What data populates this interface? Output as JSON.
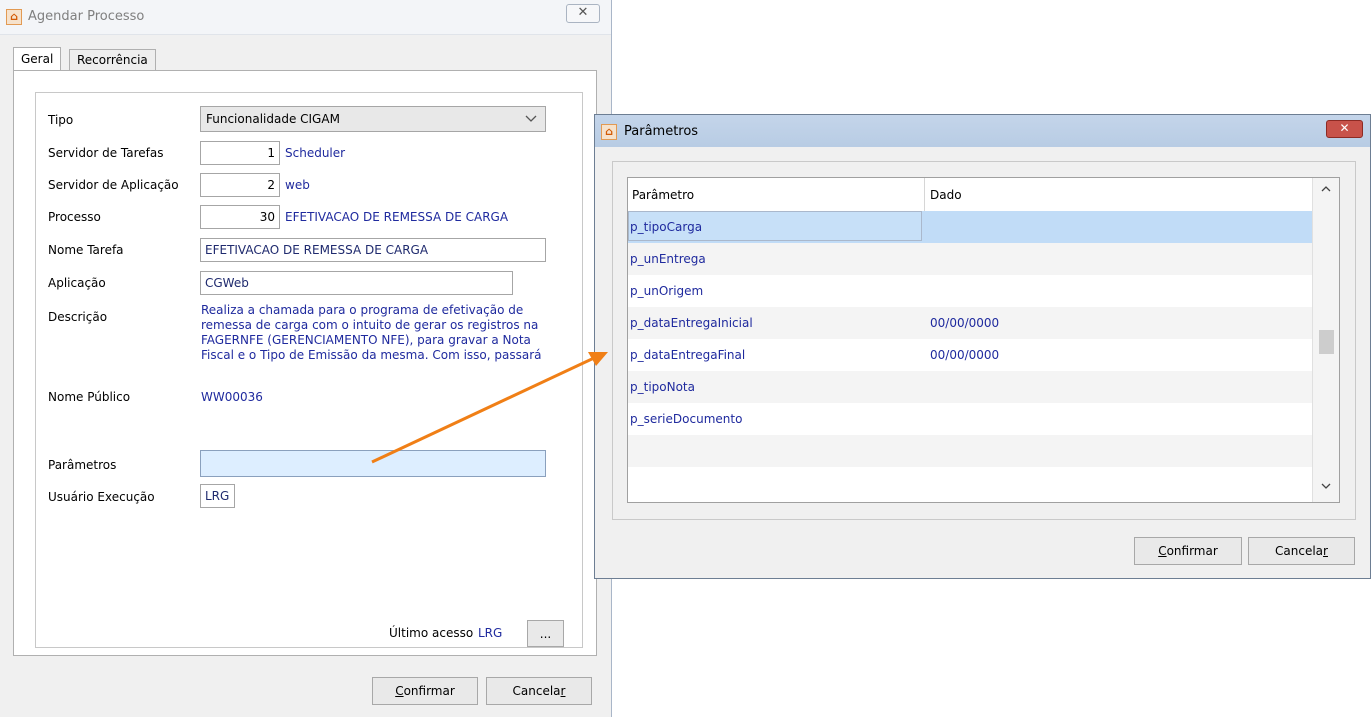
{
  "main_window": {
    "title": "Agendar Processo",
    "close_label": "✕",
    "tabs": [
      {
        "label": "Geral"
      },
      {
        "label": "Recorrência"
      }
    ],
    "form": {
      "tipo": {
        "label": "Tipo",
        "value": "Funcionalidade CIGAM"
      },
      "servidor_tarefas": {
        "label": "Servidor de Tarefas",
        "code": "1",
        "name": "Scheduler"
      },
      "servidor_aplicacao": {
        "label": "Servidor de Aplicação",
        "code": "2",
        "name": "web"
      },
      "processo": {
        "label": "Processo",
        "code": "30",
        "name": "EFETIVACAO DE REMESSA DE CARGA"
      },
      "nome_tarefa": {
        "label": "Nome Tarefa",
        "value": "EFETIVACAO DE REMESSA DE CARGA"
      },
      "aplicacao": {
        "label": "Aplicação",
        "value": "CGWeb"
      },
      "descricao": {
        "label": "Descrição",
        "lines": [
          "Realiza a chamada para o programa de efetivação de",
          "remessa de carga com o intuito de gerar os registros na",
          "FAGERNFE (GERENCIAMENTO NFE), para gravar a Nota",
          "Fiscal e o Tipo de Emissão da mesma. Com isso, passará"
        ]
      },
      "nome_publico": {
        "label": "Nome Público",
        "value": "WW00036"
      },
      "parametros": {
        "label": "Parâmetros",
        "value": ""
      },
      "usuario_execucao": {
        "label": "Usuário Execução",
        "value": "LRG"
      },
      "ultimo_acesso": {
        "label": "Último acesso",
        "value": "LRG",
        "button": "..."
      }
    },
    "buttons": {
      "confirm_mnemonic": "C",
      "confirm_rest": "onfirmar",
      "cancel_main": "Cancela",
      "cancel_mnemonic": "r"
    }
  },
  "params_dialog": {
    "title": "Parâmetros",
    "close_label": "✕",
    "columns": [
      "Parâmetro",
      "Dado"
    ],
    "rows": [
      {
        "param": "p_tipoCarga",
        "dado": ""
      },
      {
        "param": "p_unEntrega",
        "dado": ""
      },
      {
        "param": "p_unOrigem",
        "dado": ""
      },
      {
        "param": "p_dataEntregaInicial",
        "dado": "00/00/0000"
      },
      {
        "param": "p_dataEntregaFinal",
        "dado": "00/00/0000"
      },
      {
        "param": "p_tipoNota",
        "dado": ""
      },
      {
        "param": "p_serieDocumento",
        "dado": ""
      }
    ],
    "scroll_up": "^",
    "scroll_down": "v",
    "buttons": {
      "confirm_mnemonic": "C",
      "confirm_rest": "onfirmar",
      "cancel_main": "Cancela",
      "cancel_mnemonic": "r"
    }
  },
  "colors": {
    "link_blue": "#1f2a9e",
    "selection": "#c1dcf7",
    "annotation_arrow": "#f07f16",
    "close_red": "#c8524a"
  }
}
